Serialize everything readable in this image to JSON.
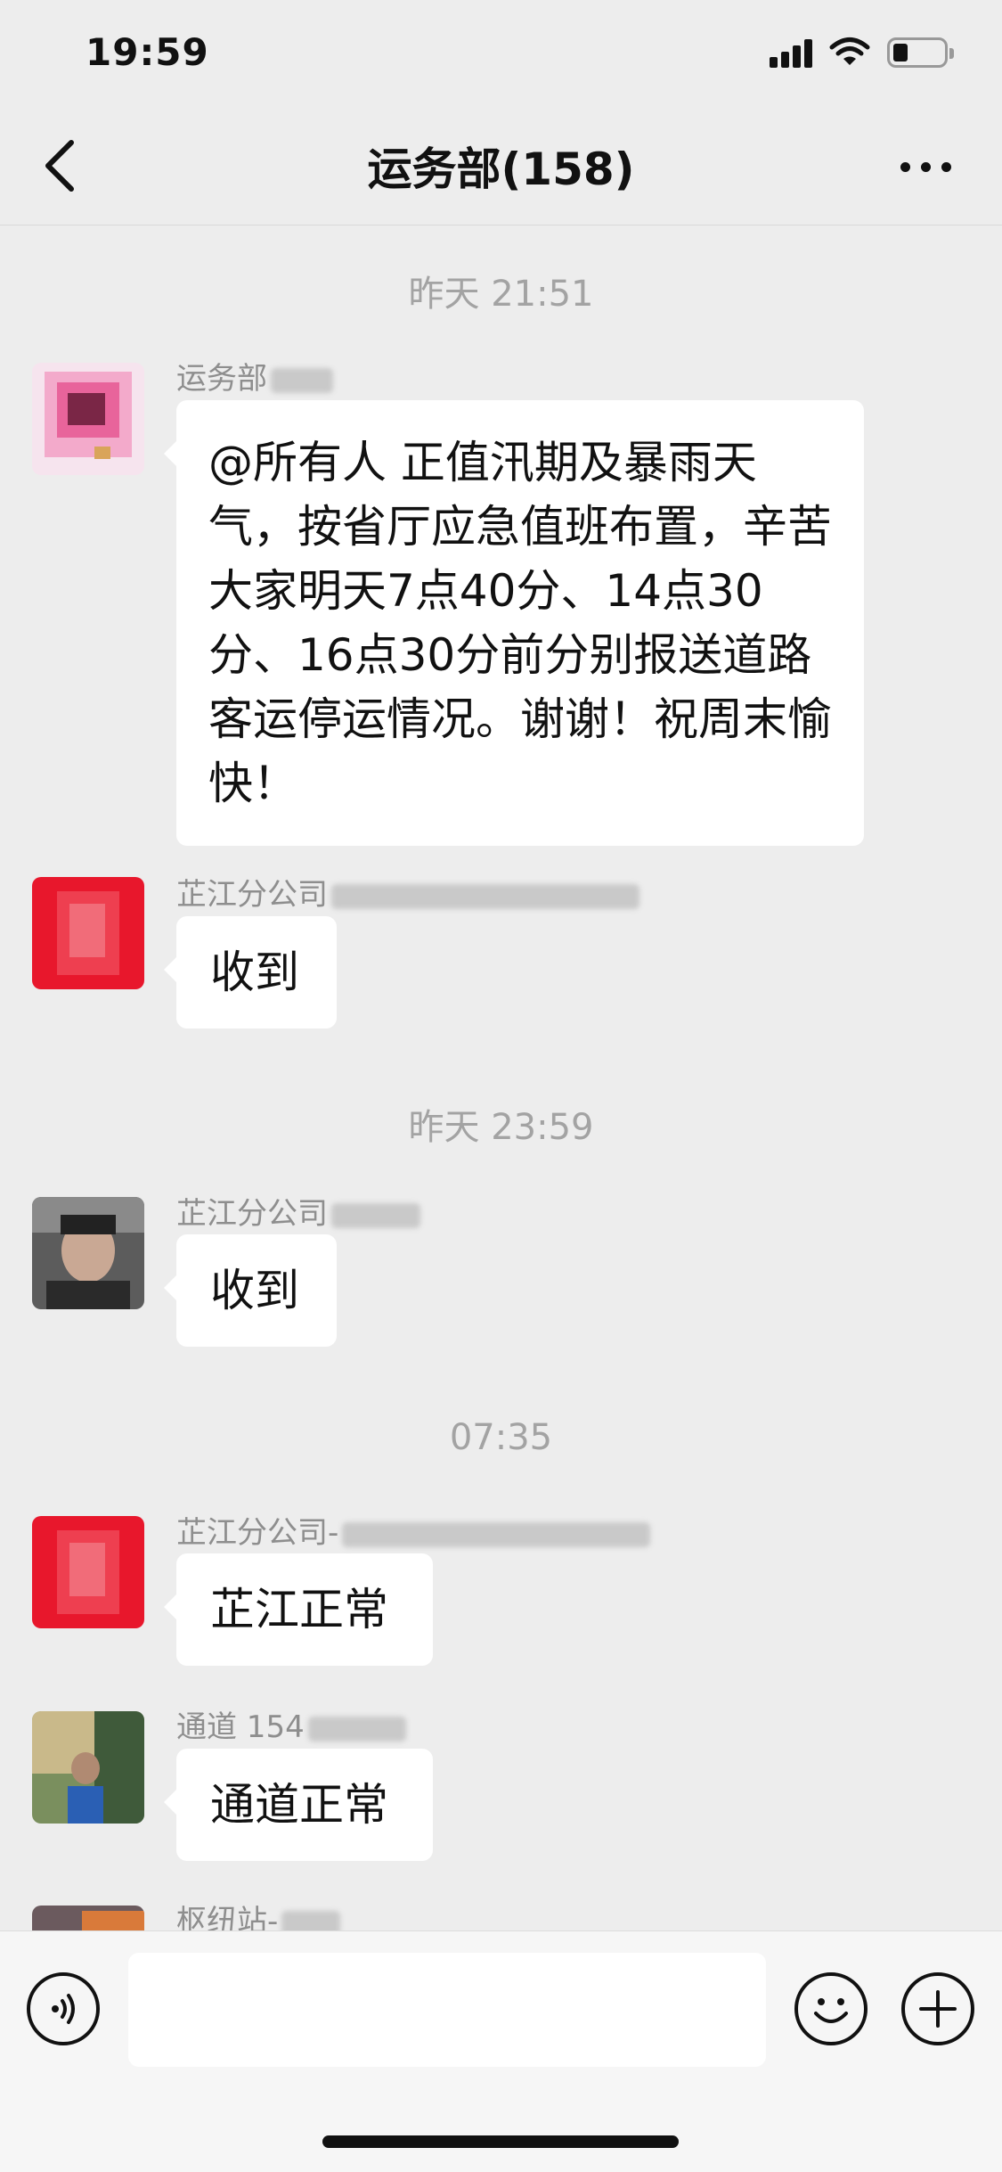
{
  "status": {
    "time": "19:59"
  },
  "header": {
    "title": "运务部(158)"
  },
  "timestamps": [
    "昨天 21:51",
    "昨天 23:59",
    "07:35"
  ],
  "messages": [
    {
      "sender": "运务部",
      "text": "@所有人 正值汛期及暴雨天气，按省厅应急值班布置，辛苦大家明天7点40分、14点30分、16点30分前分别报送道路客运停运情况。谢谢！祝周末愉快！"
    },
    {
      "sender": "芷江分公司",
      "text": "收到"
    },
    {
      "sender": "芷江分公司",
      "text": "收到"
    },
    {
      "sender": "芷江分公司-",
      "text": "芷江正常"
    },
    {
      "sender": "通道 154",
      "text": "通道正常"
    },
    {
      "sender": "枢纽站-",
      "text": ""
    }
  ],
  "input": {
    "placeholder": ""
  },
  "icons": {
    "back": "chevron-left-icon",
    "more": "more-dots-icon",
    "voice": "voice-icon",
    "emoji": "emoji-icon",
    "plus": "plus-icon"
  },
  "colors": {
    "background": "#ededed",
    "bubble": "#ffffff",
    "meta_text": "#a3a3a3"
  }
}
